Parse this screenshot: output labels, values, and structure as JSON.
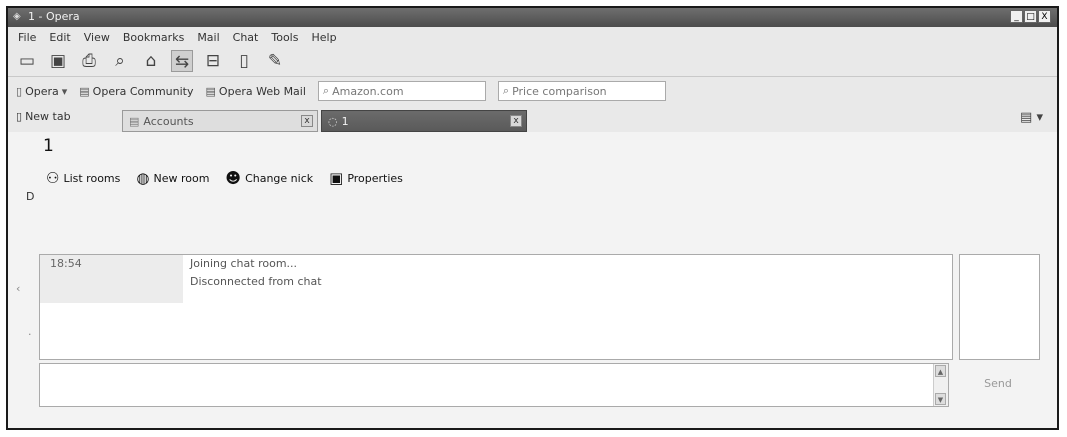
{
  "window": {
    "title": "1 - Opera",
    "controls": [
      "_",
      "□",
      "X"
    ]
  },
  "menu": [
    "File",
    "Edit",
    "View",
    "Bookmarks",
    "Mail",
    "Chat",
    "Tools",
    "Help"
  ],
  "toolbar_icons": [
    "folder-icon",
    "save-icon",
    "print-icon",
    "find-icon",
    "home-icon",
    "hotlist-icon",
    "split-panel-icon",
    "page-icon",
    "edit-icon"
  ],
  "bookmarks": {
    "opera_menu": "Opera",
    "community": "Opera Community",
    "webmail": "Opera Web Mail",
    "search1_placeholder": "Amazon.com",
    "search2_placeholder": "Price comparison"
  },
  "tabs": {
    "new_tab": "New tab",
    "items": [
      {
        "label": "Accounts",
        "close": "x"
      },
      {
        "label": "1",
        "close": "x"
      }
    ],
    "menu_glyph": "▾"
  },
  "room": {
    "title": "1",
    "left_mark": "D",
    "toolbar": [
      "List rooms",
      "New room",
      "Change nick",
      "Properties"
    ]
  },
  "messages": [
    {
      "time": "18:54",
      "text": "Joining chat room..."
    },
    {
      "time": "",
      "text": "Disconnected from chat"
    }
  ],
  "input": {
    "send_label": "Send"
  }
}
